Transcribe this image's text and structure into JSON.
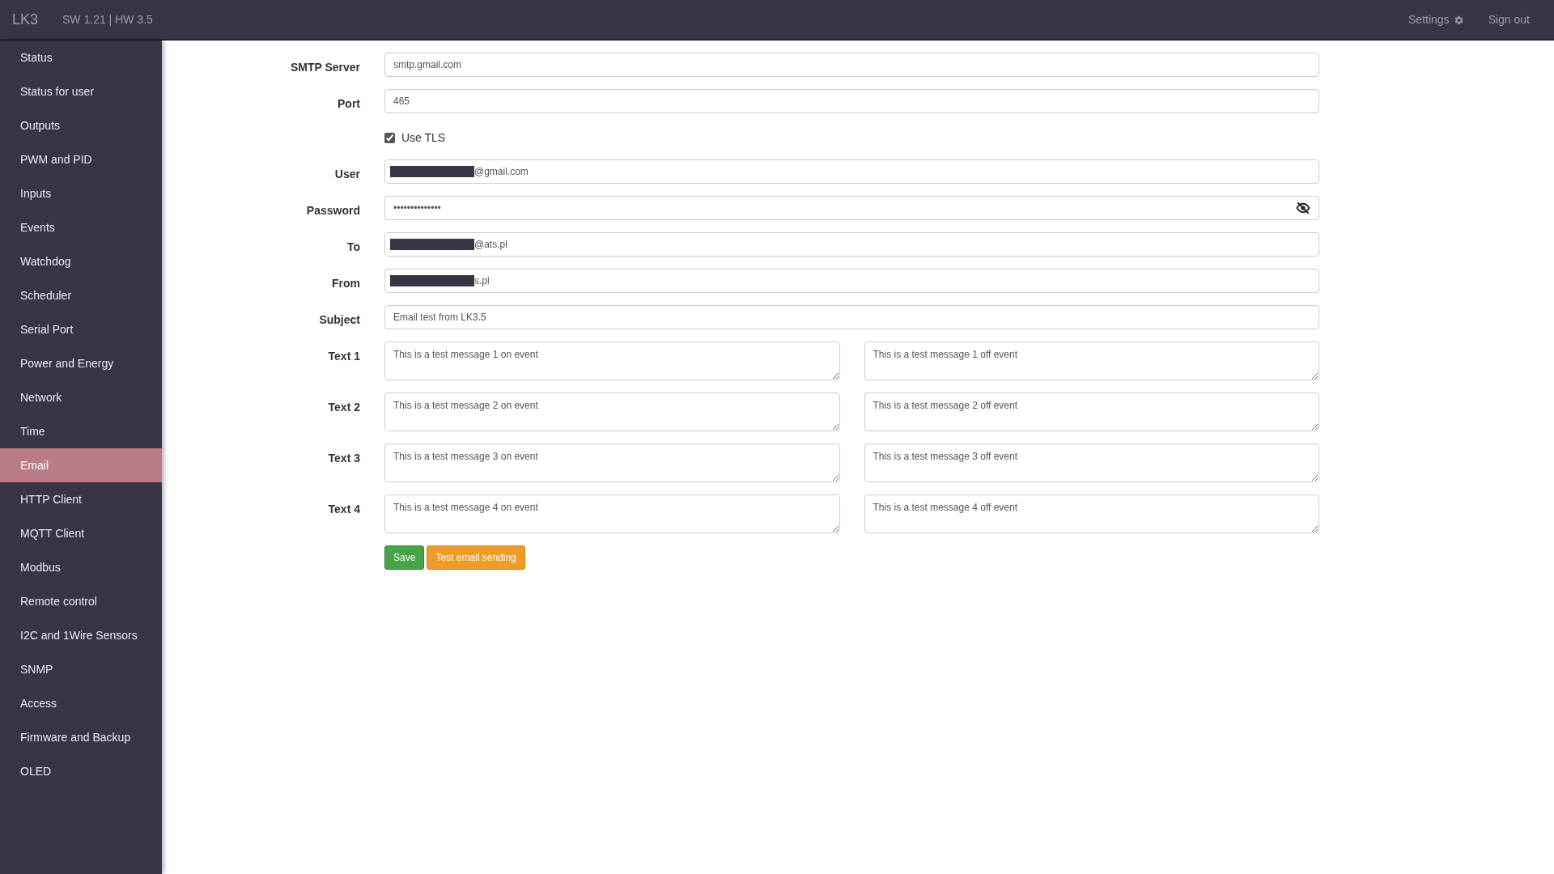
{
  "header": {
    "logo": "LK3",
    "version": "SW 1.21 | HW 3.5",
    "settings": "Settings",
    "sign_out": "Sign out"
  },
  "sidebar": {
    "items": [
      {
        "label": "Status",
        "selected": false
      },
      {
        "label": "Status for user",
        "selected": false
      },
      {
        "label": "Outputs",
        "selected": false
      },
      {
        "label": "PWM and PID",
        "selected": false
      },
      {
        "label": "Inputs",
        "selected": false
      },
      {
        "label": "Events",
        "selected": false
      },
      {
        "label": "Watchdog",
        "selected": false
      },
      {
        "label": "Scheduler",
        "selected": false
      },
      {
        "label": "Serial Port",
        "selected": false
      },
      {
        "label": "Power and Energy",
        "selected": false
      },
      {
        "label": "Network",
        "selected": false
      },
      {
        "label": "Time",
        "selected": false
      },
      {
        "label": "Email",
        "selected": true
      },
      {
        "label": "HTTP Client",
        "selected": false
      },
      {
        "label": "MQTT Client",
        "selected": false
      },
      {
        "label": "Modbus",
        "selected": false
      },
      {
        "label": "Remote control",
        "selected": false
      },
      {
        "label": "I2C and 1Wire Sensors",
        "selected": false
      },
      {
        "label": "SNMP",
        "selected": false
      },
      {
        "label": "Access",
        "selected": false
      },
      {
        "label": "Firmware and Backup",
        "selected": false
      },
      {
        "label": "OLED",
        "selected": false
      }
    ]
  },
  "form": {
    "fields": [
      {
        "kind": "text",
        "label": "SMTP Server",
        "value": "smtp.gmail.com",
        "redacted": false
      },
      {
        "kind": "text",
        "label": "Port",
        "value": "465",
        "redacted": false
      },
      {
        "kind": "checkbox",
        "label": "Use TLS",
        "checked": true
      },
      {
        "kind": "text",
        "label": "User",
        "value": "@gmail.com",
        "redacted": true
      },
      {
        "kind": "password",
        "label": "Password",
        "value": "••••••••••••••",
        "redacted": false
      },
      {
        "kind": "text",
        "label": "To",
        "value": "@ats.pl",
        "redacted": true
      },
      {
        "kind": "text",
        "label": "From",
        "value": "s.pl",
        "redacted": true
      },
      {
        "kind": "text",
        "label": "Subject",
        "value": "Email test from LK3.5",
        "redacted": false
      }
    ],
    "texts": [
      {
        "label": "Text 1",
        "on": "This is a test message 1 on event",
        "off": "This is a test message 1 off event"
      },
      {
        "label": "Text 2",
        "on": "This is a test message 2 on event",
        "off": "This is a test message 2 off event"
      },
      {
        "label": "Text 3",
        "on": "This is a test message 3 on event",
        "off": "This is a test message 3 off event"
      },
      {
        "label": "Text 4",
        "on": "This is a test message 4 on event",
        "off": "This is a test message 4 off event"
      }
    ],
    "buttons": [
      {
        "kind": "save",
        "label": "Save"
      },
      {
        "kind": "test",
        "label": "Test email sending"
      }
    ]
  }
}
